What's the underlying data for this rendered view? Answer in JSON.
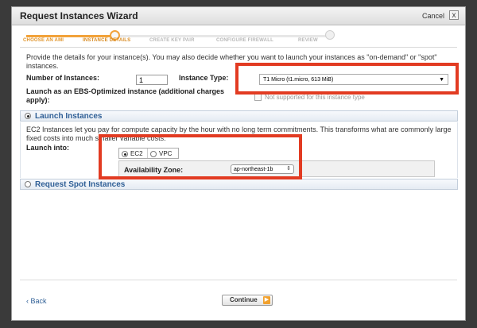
{
  "window": {
    "title": "Request Instances Wizard",
    "cancel_label": "Cancel",
    "close_glyph": "x"
  },
  "steps": [
    {
      "label": "CHOOSE AN AMI",
      "state": "done"
    },
    {
      "label": "INSTANCE DETAILS",
      "state": "active"
    },
    {
      "label": "CREATE KEY PAIR",
      "state": "todo"
    },
    {
      "label": "CONFIGURE FIREWALL",
      "state": "todo"
    },
    {
      "label": "REVIEW",
      "state": "todo"
    }
  ],
  "intro": "Provide the details for your instance(s). You may also decide whether you want to launch your instances as \"on-demand\" or \"spot\" instances.",
  "form": {
    "num_instances_label": "Number of Instances:",
    "num_instances_value": "1",
    "instance_type_label": "Instance Type:",
    "instance_type_value": "T1 Micro (t1.micro, 613 MiB)",
    "ebs_label": "Launch as an EBS-Optimized instance (additional charges apply):",
    "ebs_note": "Not supported for this instance type"
  },
  "launch": {
    "section_title": "Launch Instances",
    "description": "EC2 Instances let you pay for compute capacity by the hour with no long term commitments. This transforms what are commonly large fixed costs into much smaller variable costs.",
    "launch_into_label": "Launch into:",
    "option_ec2": "EC2",
    "option_vpc": "VPC",
    "az_label": "Availability Zone:",
    "az_value": "ap-northeast-1b"
  },
  "spot": {
    "section_title": "Request Spot Instances"
  },
  "footer": {
    "back_label": "Back",
    "back_glyph": "‹",
    "continue_label": "Continue",
    "continue_glyph": "▶"
  },
  "colors": {
    "highlight": "#e23b22",
    "accent": "#f2a23a",
    "link": "#2f5f96"
  }
}
